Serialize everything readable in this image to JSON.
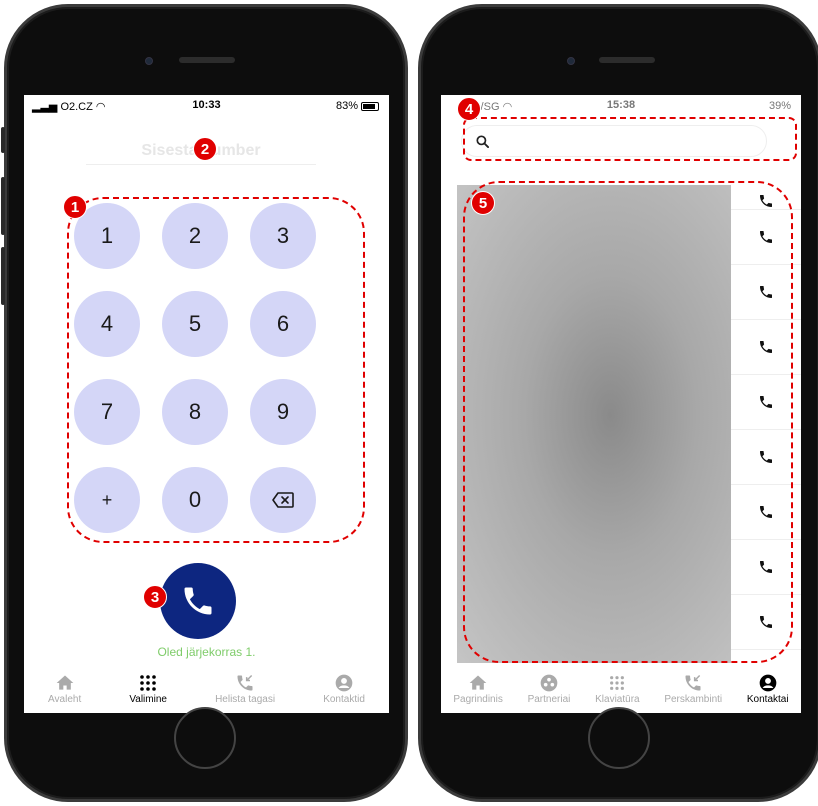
{
  "left_phone": {
    "status": {
      "carrier": "O2.CZ",
      "time": "10:33",
      "battery": "83%"
    },
    "number_field": {
      "placeholder": "Sisesta number"
    },
    "keys": [
      "1",
      "2",
      "3",
      "4",
      "5",
      "6",
      "7",
      "8",
      "9",
      "+",
      "0"
    ],
    "queue_text": "Oled järjekorras 1.",
    "tabs": [
      {
        "label": "Avaleht",
        "icon": "home-icon"
      },
      {
        "label": "Valimine",
        "icon": "dialpad-icon"
      },
      {
        "label": "Helista tagasi",
        "icon": "callback-icon"
      },
      {
        "label": "Kontaktid",
        "icon": "contacts-icon"
      }
    ],
    "active_tab": "Valimine"
  },
  "right_phone": {
    "status": {
      "carrier": "Cnc/SG",
      "time": "15:38",
      "battery": "39%"
    },
    "search": {
      "placeholder": ""
    },
    "tabs": [
      {
        "label": "Pagrindinis",
        "icon": "home-icon"
      },
      {
        "label": "Partneriai",
        "icon": "partners-icon"
      },
      {
        "label": "Klaviatūra",
        "icon": "dialpad-icon"
      },
      {
        "label": "Perskambinti",
        "icon": "callback-icon"
      },
      {
        "label": "Kontaktai",
        "icon": "contacts-icon"
      }
    ],
    "active_tab": "Kontaktai"
  },
  "callouts": [
    "1",
    "2",
    "3",
    "4",
    "5"
  ],
  "colors": {
    "key_bg": "#d4d6f7",
    "call_button": "#0d2680",
    "queue_text": "#7fcc6a",
    "callout_red": "#e00000"
  }
}
